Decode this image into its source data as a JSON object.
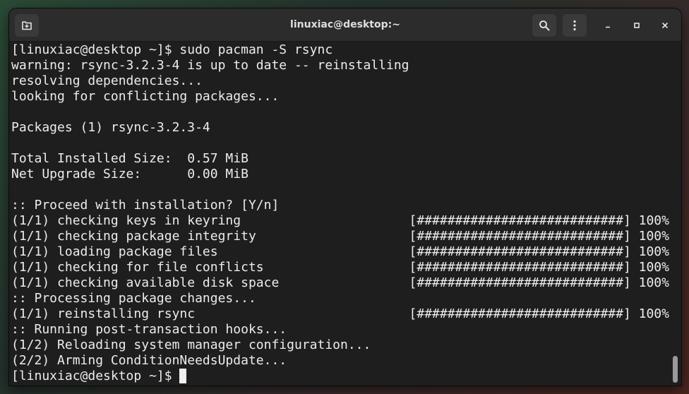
{
  "window": {
    "title": "linuxiac@desktop:~"
  },
  "toolbar": {
    "new_tab_icon": "new-tab-icon",
    "search_icon": "search-icon",
    "menu_icon": "kebab-menu-icon",
    "minimize_icon": "minimize-icon",
    "maximize_icon": "maximize-icon",
    "close_icon": "close-icon"
  },
  "terminal": {
    "lines": [
      "[linuxiac@desktop ~]$ sudo pacman -S rsync",
      "warning: rsync-3.2.3-4 is up to date -- reinstalling",
      "resolving dependencies...",
      "looking for conflicting packages...",
      "",
      "Packages (1) rsync-3.2.3-4",
      "",
      "Total Installed Size:  0.57 MiB",
      "Net Upgrade Size:      0.00 MiB",
      "",
      ":: Proceed with installation? [Y/n]",
      "(1/1) checking keys in keyring                      [###########################] 100%",
      "(1/1) checking package integrity                    [###########################] 100%",
      "(1/1) loading package files                         [###########################] 100%",
      "(1/1) checking for file conflicts                   [###########################] 100%",
      "(1/1) checking available disk space                 [###########################] 100%",
      ":: Processing package changes...",
      "(1/1) reinstalling rsync                            [###########################] 100%",
      ":: Running post-transaction hooks...",
      "(1/2) Reloading system manager configuration...",
      "(2/2) Arming ConditionNeedsUpdate..."
    ],
    "prompt": "[linuxiac@desktop ~]$ "
  },
  "colors": {
    "background": "#1e1e1e",
    "headerbar": "#2c2c2c",
    "foreground": "#ececec"
  }
}
